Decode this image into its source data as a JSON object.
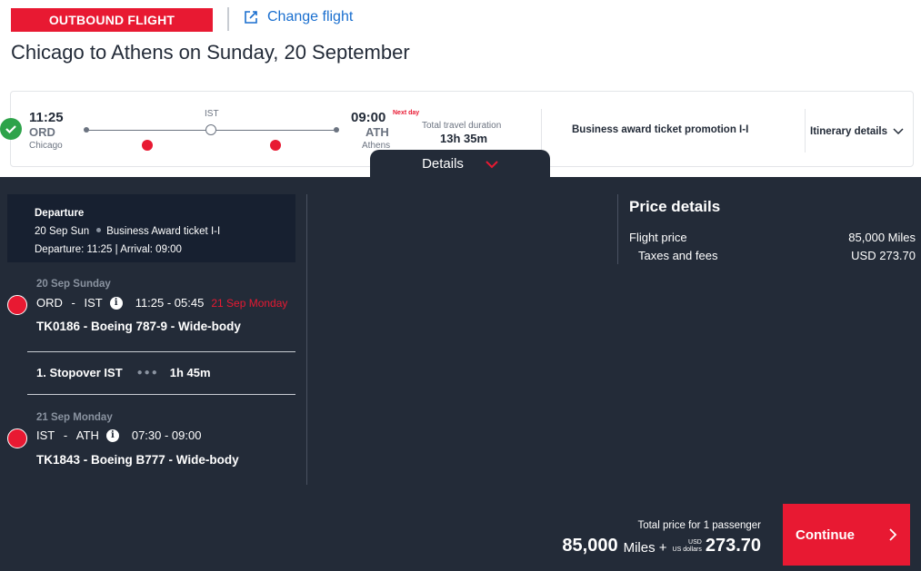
{
  "header": {
    "badge": "OUTBOUND FLIGHT",
    "change_flight": "Change flight",
    "title": "Chicago to Athens on Sunday, 20 September"
  },
  "summary": {
    "dep_time": "11:25",
    "dep_code": "ORD",
    "dep_city": "Chicago",
    "stop_code": "IST",
    "arr_time": "09:00",
    "next_day": "Next day",
    "arr_code": "ATH",
    "arr_city": "Athens",
    "duration_label": "Total travel duration",
    "duration": "13h 35m",
    "fare": "Business award ticket promotion I-I",
    "itinerary": "Itinerary details"
  },
  "details_tab": "Details",
  "departure_box": {
    "title": "Departure",
    "date": "20 Sep Sun",
    "ticket": "Business Award ticket I-I",
    "times": "Departure: 11:25 | Arrival: 09:00"
  },
  "segments": [
    {
      "date": "20 Sep Sunday",
      "from": "ORD",
      "to": "IST",
      "times": "11:25 - 05:45",
      "arrival_note": "21 Sep Monday",
      "flight": "TK0186 - Boeing 787-9 - Wide-body"
    },
    {
      "date": "21 Sep Monday",
      "from": "IST",
      "to": "ATH",
      "times": "07:30 - 09:00",
      "arrival_note": "",
      "flight": "TK1843 - Boeing B777 - Wide-body"
    }
  ],
  "stopover": {
    "label": "1. Stopover IST",
    "duration": "1h 45m"
  },
  "price": {
    "title": "Price details",
    "flight_label": "Flight price",
    "flight_value": "85,000 Miles",
    "tax_label": "Taxes and fees",
    "tax_value": "USD 273.70"
  },
  "total": {
    "label": "Total price for 1 passenger",
    "miles": "85,000",
    "miles_unit": "Miles +",
    "usd_top": "USD",
    "usd_bottom": "US dollars",
    "amount": "273.70"
  },
  "continue": "Continue",
  "colors": {
    "brand_red": "#e81932",
    "panel": "#232b38",
    "link_blue": "#1a6fcf",
    "success": "#2ea34a"
  }
}
